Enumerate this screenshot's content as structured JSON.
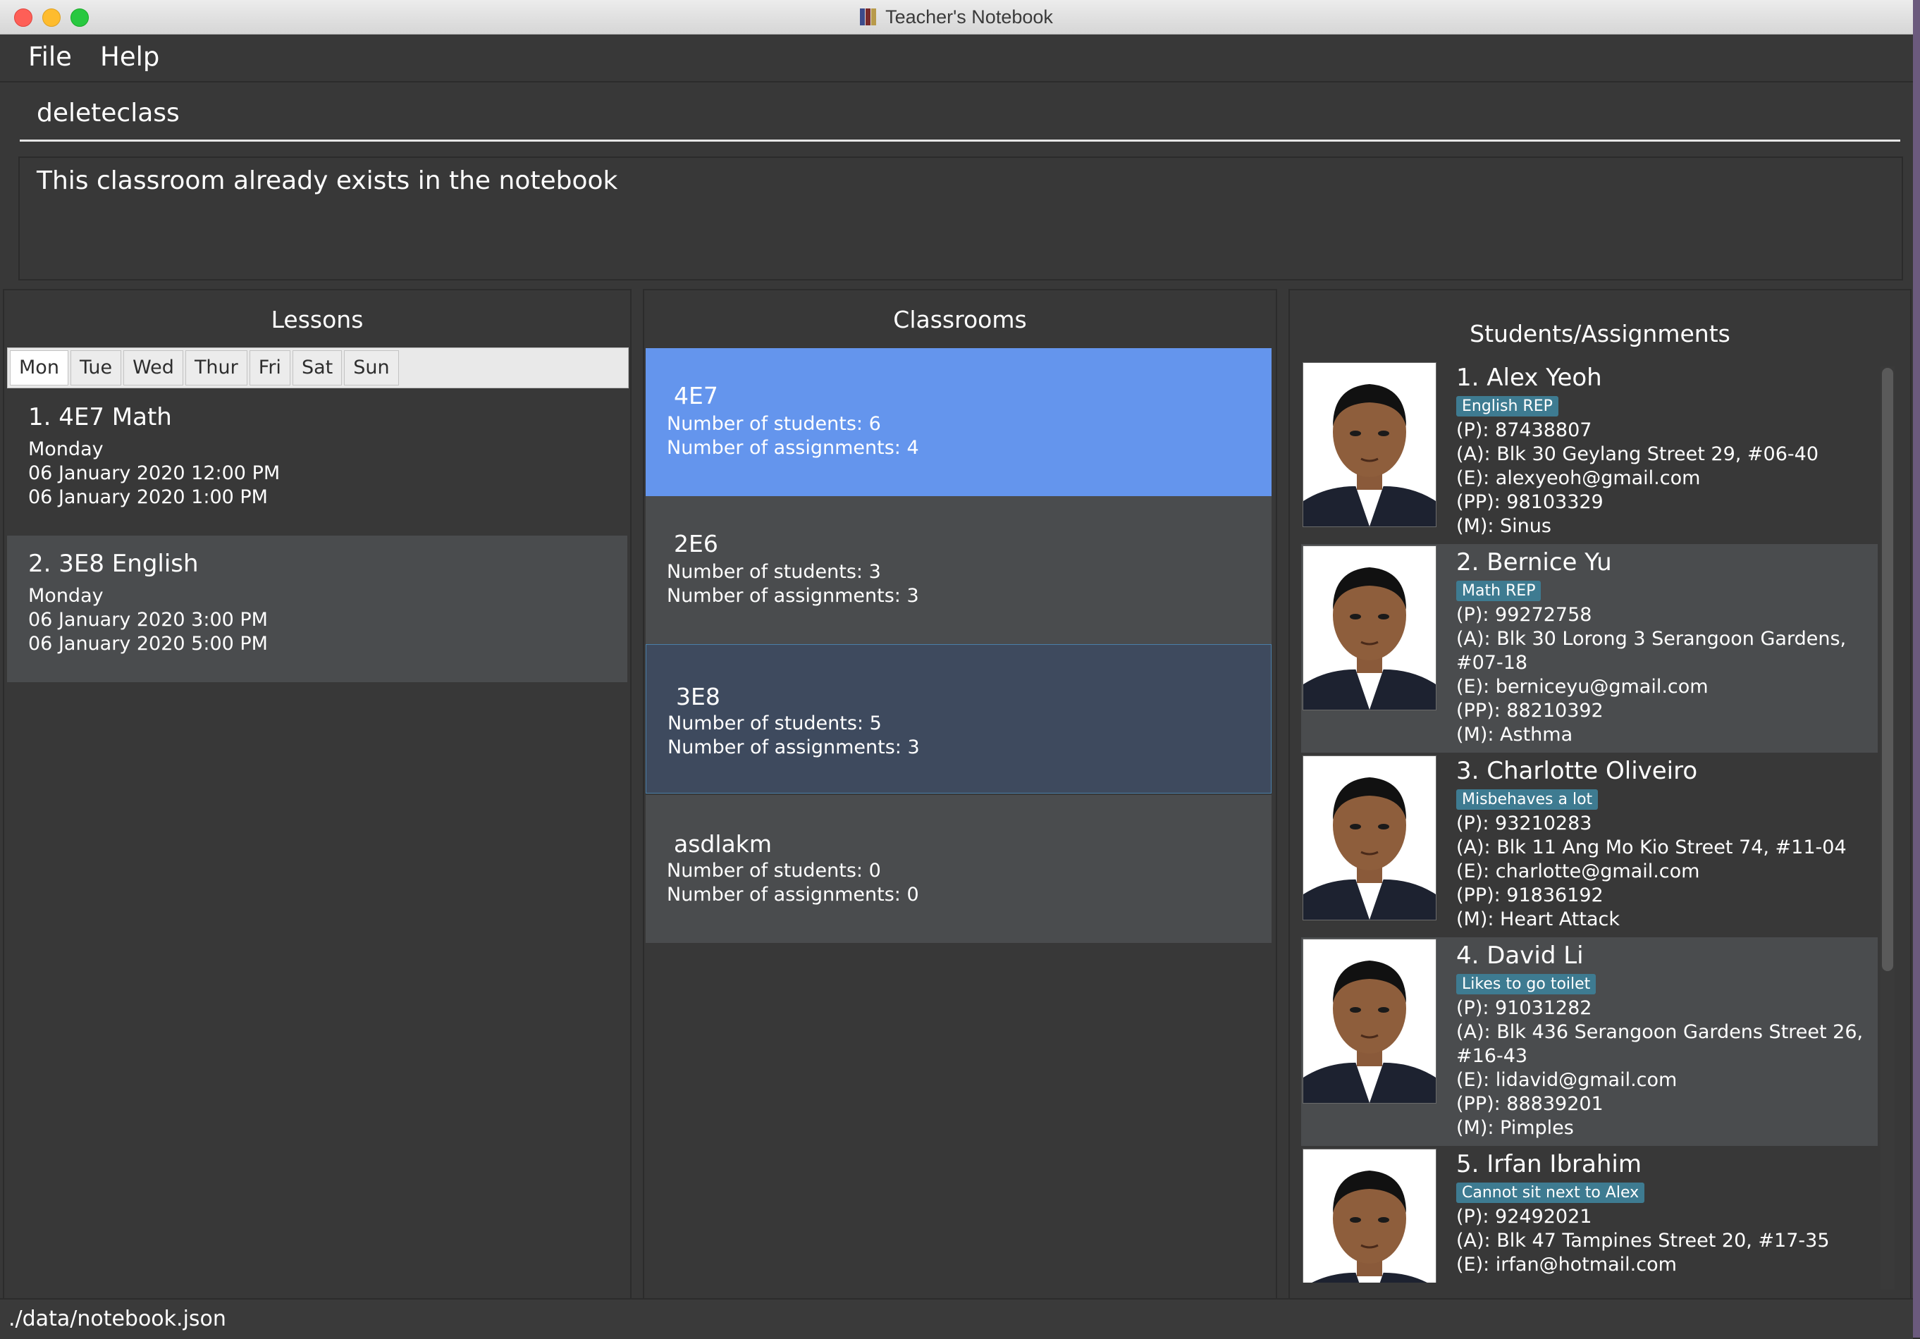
{
  "window": {
    "title": "Teacher's Notebook"
  },
  "menu": [
    {
      "label": "File"
    },
    {
      "label": "Help"
    }
  ],
  "command": {
    "text": "deleteclass"
  },
  "result": {
    "text": "This classroom already exists in the notebook"
  },
  "lessons": {
    "title": "Lessons",
    "tabs": [
      "Mon",
      "Tue",
      "Wed",
      "Thur",
      "Fri",
      "Sat",
      "Sun"
    ],
    "selected_tab": "Mon",
    "items": [
      {
        "title": "1.  4E7 Math",
        "day": "Monday",
        "start": "06 January 2020 12:00 PM",
        "end": "06 January 2020 1:00 PM"
      },
      {
        "title": "2.  3E8 English",
        "day": "Monday",
        "start": "06 January 2020 3:00 PM",
        "end": "06 January 2020 5:00 PM"
      }
    ]
  },
  "classrooms": {
    "title": "Classrooms",
    "items": [
      {
        "name": "4E7",
        "students": "Number of students: 6",
        "assignments": "Number of assignments: 4"
      },
      {
        "name": "2E6",
        "students": "Number of students: 3",
        "assignments": "Number of assignments: 3"
      },
      {
        "name": "3E8",
        "students": "Number of students: 5",
        "assignments": "Number of assignments: 3"
      },
      {
        "name": "asdlakm",
        "students": "Number of students: 0",
        "assignments": "Number of assignments: 0"
      }
    ]
  },
  "students": {
    "title": "Students/Assignments",
    "items": [
      {
        "name": "1.  Alex Yeoh",
        "tag": "English REP",
        "phone": "(P): 87438807",
        "address": "(A): Blk 30 Geylang Street 29, #06-40",
        "email": "(E): alexyeoh@gmail.com",
        "parent_phone": "(PP): 98103329",
        "medical": "(M): Sinus"
      },
      {
        "name": "2.  Bernice Yu",
        "tag": "Math REP",
        "phone": "(P): 99272758",
        "address": "(A): Blk 30 Lorong 3 Serangoon Gardens, #07-18",
        "email": "(E): berniceyu@gmail.com",
        "parent_phone": "(PP): 88210392",
        "medical": "(M): Asthma"
      },
      {
        "name": "3.  Charlotte Oliveiro",
        "tag": "Misbehaves a lot",
        "phone": "(P): 93210283",
        "address": "(A): Blk 11 Ang Mo Kio Street 74, #11-04",
        "email": "(E): charlotte@gmail.com",
        "parent_phone": "(PP): 91836192",
        "medical": "(M): Heart Attack"
      },
      {
        "name": "4.  David Li",
        "tag": "Likes to go toilet",
        "phone": "(P): 91031282",
        "address": "(A): Blk 436 Serangoon Gardens Street 26, #16-43",
        "email": "(E): lidavid@gmail.com",
        "parent_phone": "(PP): 88839201",
        "medical": "(M): Pimples"
      },
      {
        "name": "5.  Irfan Ibrahim",
        "tag": "Cannot sit next to Alex",
        "phone": "(P): 92492021",
        "address": "(A): Blk 47 Tampines Street 20, #17-35",
        "email": "(E): irfan@hotmail.com",
        "parent_phone": "",
        "medical": ""
      }
    ]
  },
  "status": {
    "path": "./data/notebook.json"
  },
  "colors": {
    "background": "#383838",
    "selected_classroom": "#6495ed",
    "highlight_classroom": "#3e4a5e",
    "tag": "#3e7b91"
  }
}
